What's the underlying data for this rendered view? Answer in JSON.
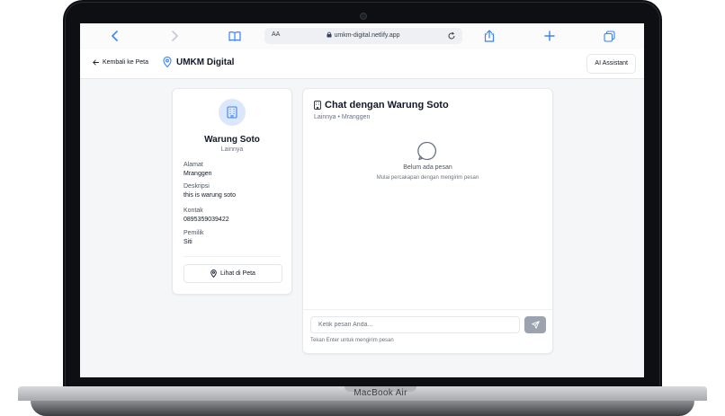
{
  "device": {
    "brand_label": "MacBook Air"
  },
  "browser": {
    "text_size_label": "AA",
    "url": "umkm-digital.netlify.app",
    "icons": [
      "chevron-left-icon",
      "chevron-right-icon",
      "book-icon",
      "lock-icon",
      "reload-icon",
      "share-icon",
      "plus-icon",
      "tabs-icon"
    ]
  },
  "header": {
    "back_label": "Kembali ke Peta",
    "app_title": "UMKM Digital",
    "ai_button": "AI Assistant"
  },
  "shop": {
    "name": "Warung Soto",
    "category": "Lainnya",
    "fields": [
      {
        "label": "Alamat",
        "value": "Mranggen"
      },
      {
        "label": "Deskripsi",
        "value": "this is warung soto"
      },
      {
        "label": "Kontak",
        "value": "0895359039422"
      },
      {
        "label": "Pemilik",
        "value": "Siti"
      }
    ],
    "map_button": "Lihat di Peta"
  },
  "chat": {
    "title": "Chat dengan Warung Soto",
    "subtitle": "Lainnya • Mranggen",
    "empty_title": "Belum ada pesan",
    "empty_subtitle": "Mulai percakapan dengan mengirim pesan",
    "input_placeholder": "Ketik pesan Anda...",
    "input_value": "",
    "hint": "Tekan Enter untuk mengirim pesan"
  },
  "colors": {
    "accent": "#3b82f6",
    "send_button": "#9ca3af",
    "background": "#f5f6f8"
  }
}
